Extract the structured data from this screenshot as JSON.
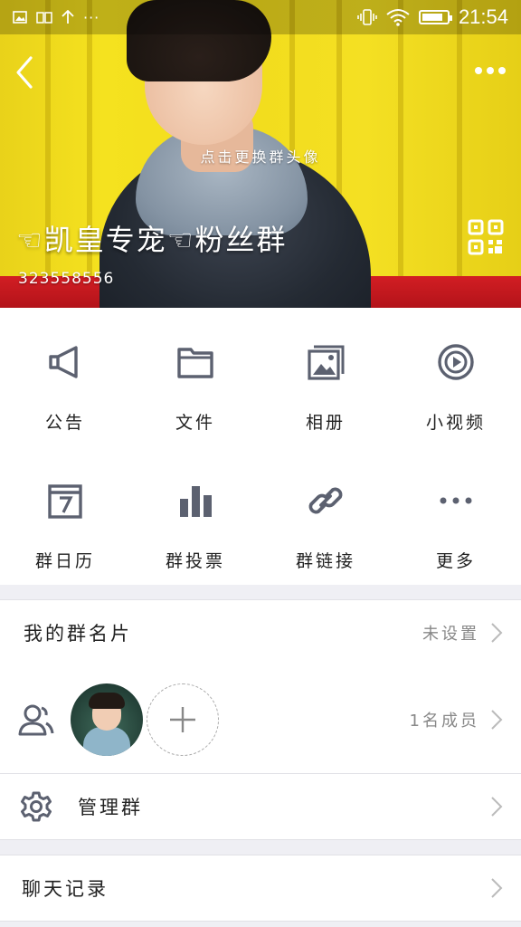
{
  "status_bar": {
    "time": "21:54",
    "left_icons": [
      "image-icon",
      "book-icon",
      "upload-arrow-icon",
      "ellipsis-icon"
    ],
    "right_icons": [
      "vibrate-icon",
      "wifi-icon",
      "battery-icon"
    ],
    "battery_level": 0.85
  },
  "cover": {
    "hint": "点击更换群头像",
    "group_name": "☜凯皇专宠☜粉丝群",
    "group_id": "323558556"
  },
  "features": [
    {
      "label": "公告",
      "icon": "megaphone-icon"
    },
    {
      "label": "文件",
      "icon": "folder-icon"
    },
    {
      "label": "相册",
      "icon": "album-icon"
    },
    {
      "label": "小视频",
      "icon": "video-play-icon"
    },
    {
      "label": "群日历",
      "icon": "calendar-icon"
    },
    {
      "label": "群投票",
      "icon": "bar-chart-icon"
    },
    {
      "label": "群链接",
      "icon": "link-icon"
    },
    {
      "label": "更多",
      "icon": "more-dots-icon"
    }
  ],
  "rows": {
    "card": {
      "title": "我的群名片",
      "value": "未设置"
    },
    "members": {
      "value": "1名成员"
    },
    "manage": {
      "title": "管理群"
    },
    "history": {
      "title": "聊天记录"
    }
  },
  "colors": {
    "icon_gray": "#5c6170",
    "cover_yellow": "#f2dc1c",
    "cover_red": "#c8171d",
    "page_bg": "#efeff4"
  }
}
